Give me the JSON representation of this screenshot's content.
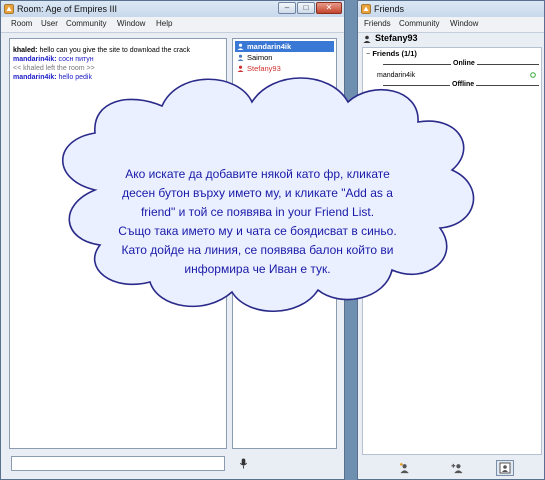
{
  "room_window": {
    "title": "Room: Age of Empires III",
    "menu": [
      "Room",
      "User",
      "Community",
      "Window",
      "Help"
    ],
    "chat": [
      {
        "user": "khaled:",
        "text": " hello can you give the site to download the crack"
      },
      {
        "user": "mandarin4ik:",
        "text": " сосн питун"
      },
      {
        "system": "<< khaled left the room >>"
      },
      {
        "user": "mandarin4ik:",
        "text": " hello pedik"
      }
    ],
    "users": [
      {
        "name": "mandarin4ik",
        "selected": true,
        "color": "#ffffff"
      },
      {
        "name": "Saimon",
        "selected": false,
        "color": "#000000"
      },
      {
        "name": "Stefany93",
        "selected": false,
        "color": "#d03030"
      }
    ],
    "message_input": {
      "value": "",
      "placeholder": ""
    }
  },
  "friends_window": {
    "title": "Friends",
    "menu": [
      "Friends",
      "Community",
      "Window"
    ],
    "profile_name": "Stefany93",
    "group_header": "Friends (1/1)",
    "online_label": "Online",
    "offline_label": "Offline",
    "friends": [
      {
        "name": "mandarin4ik",
        "status_icon": "online-dot-icon"
      }
    ],
    "toolbar_icons": [
      "add-friend-icon",
      "add-group-icon",
      "friends-list-icon"
    ]
  },
  "annotation": {
    "lines": [
      "Ако искате да добавите някой като фр, кликате",
      "десен бутон върху името му, и кликате \"Add as a",
      "friend\" и той се появява in your Friend List.",
      "Също така името му и чата се боядисват в синьо.",
      "Като дойде на линия, се появява балон който ви",
      "информира че Иван е тук."
    ]
  },
  "colors": {
    "chat_blue": "#2020c8",
    "selected_user_bg": "#3a78d6",
    "annotation_text": "#1a1aa8"
  }
}
